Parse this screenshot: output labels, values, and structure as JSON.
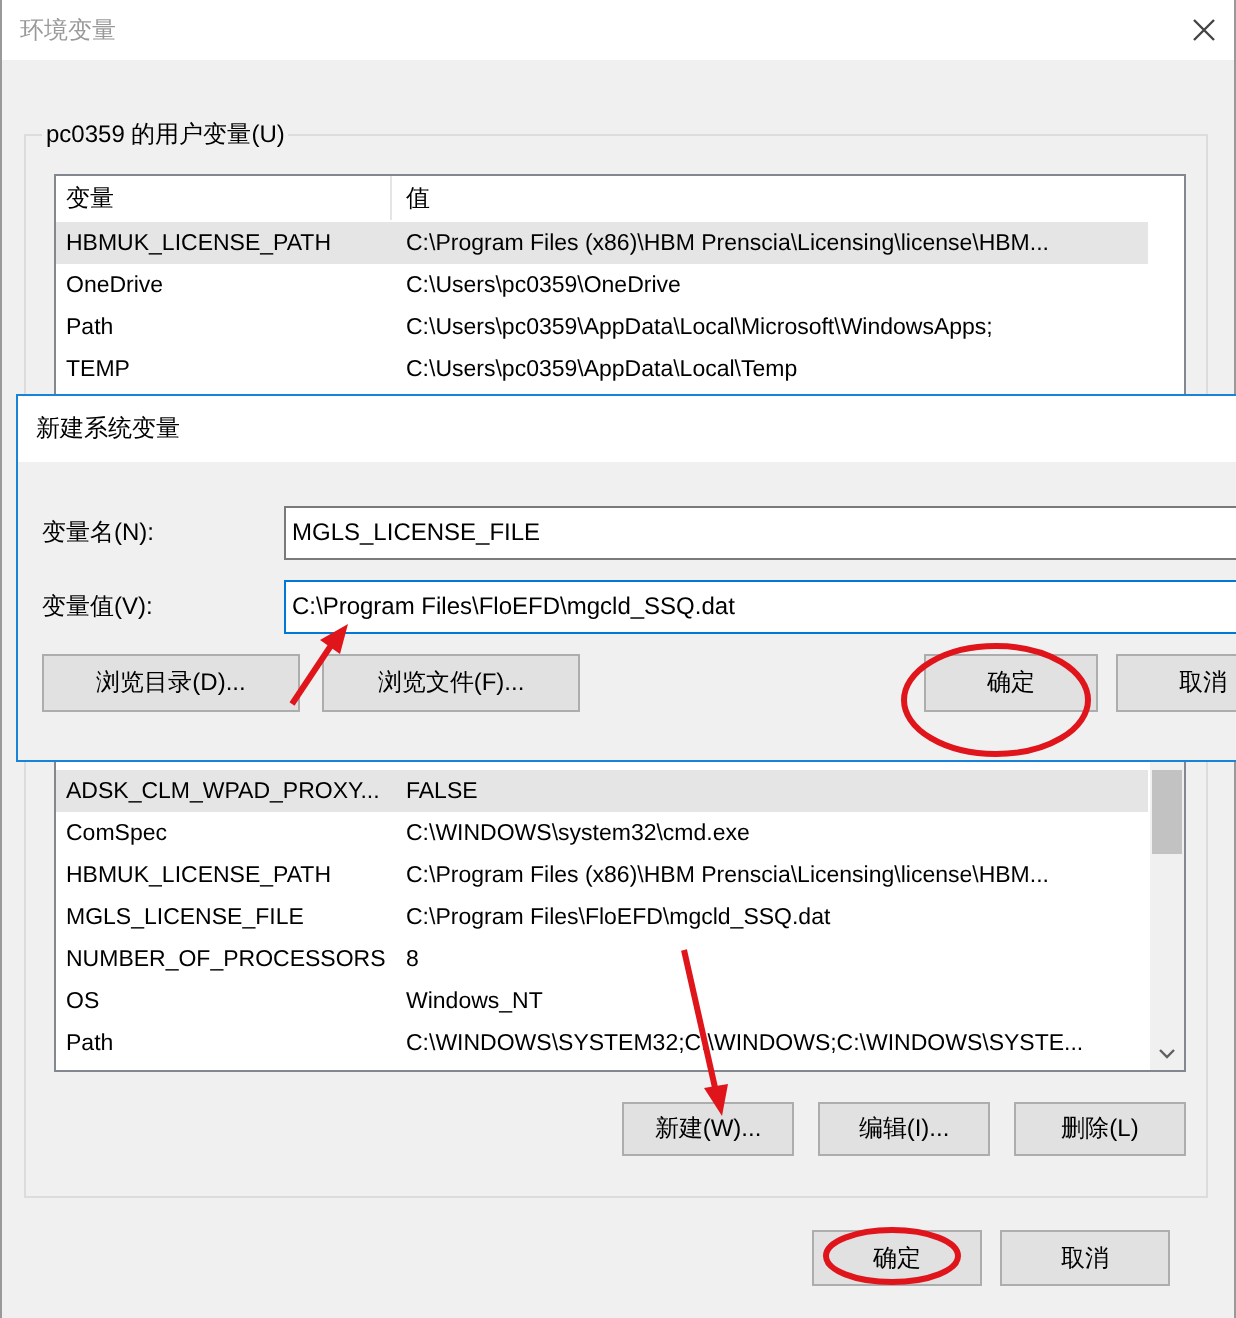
{
  "window": {
    "title": "环境变量"
  },
  "user_variables": {
    "label": "pc0359 的用户变量(U)",
    "columns": [
      "变量",
      "值"
    ],
    "rows": [
      {
        "name": "HBMUK_LICENSE_PATH",
        "value": "C:\\Program Files (x86)\\HBM Prenscia\\Licensing\\license\\HBM...",
        "selected": true
      },
      {
        "name": "OneDrive",
        "value": "C:\\Users\\pc0359\\OneDrive",
        "selected": false
      },
      {
        "name": "Path",
        "value": "C:\\Users\\pc0359\\AppData\\Local\\Microsoft\\WindowsApps;",
        "selected": false
      },
      {
        "name": "TEMP",
        "value": "C:\\Users\\pc0359\\AppData\\Local\\Temp",
        "selected": false
      }
    ]
  },
  "system_variables": {
    "rows": [
      {
        "name": "ADSK_CLM_WPAD_PROXY...",
        "value": "FALSE",
        "selected": true
      },
      {
        "name": "ComSpec",
        "value": "C:\\WINDOWS\\system32\\cmd.exe",
        "selected": false
      },
      {
        "name": "HBMUK_LICENSE_PATH",
        "value": "C:\\Program Files (x86)\\HBM Prenscia\\Licensing\\license\\HBM...",
        "selected": false
      },
      {
        "name": "MGLS_LICENSE_FILE",
        "value": "C:\\Program Files\\FloEFD\\mgcld_SSQ.dat",
        "selected": false
      },
      {
        "name": "NUMBER_OF_PROCESSORS",
        "value": "8",
        "selected": false
      },
      {
        "name": "OS",
        "value": "Windows_NT",
        "selected": false
      },
      {
        "name": "Path",
        "value": "C:\\WINDOWS\\SYSTEM32;C:\\WINDOWS;C:\\WINDOWS\\SYSTE...",
        "selected": false
      }
    ],
    "buttons": [
      "新建(W)...",
      "编辑(I)...",
      "删除(L)"
    ]
  },
  "buttons": [
    "确定",
    "取消"
  ],
  "new_variable_dialog": {
    "title": "新建系统变量",
    "fields": [
      {
        "label": "变量名(N):",
        "value": "MGLS_LICENSE_FILE",
        "focused": false
      },
      {
        "label": "变量值(V):",
        "value": "C:\\Program Files\\FloEFD\\mgcld_SSQ.dat",
        "focused": true
      }
    ],
    "buttons": [
      "浏览目录(D)...",
      "浏览文件(F)...",
      "确定",
      "取消"
    ]
  }
}
